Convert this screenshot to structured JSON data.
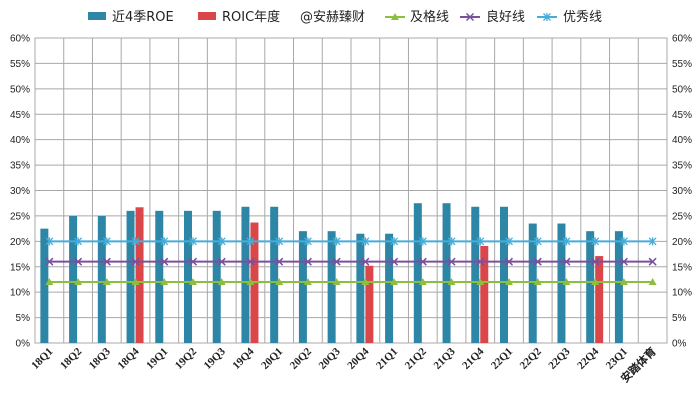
{
  "chart_data": {
    "type": "bar",
    "categories": [
      "18Q1",
      "18Q2",
      "18Q3",
      "18Q4",
      "19Q1",
      "19Q2",
      "19Q3",
      "19Q4",
      "20Q1",
      "20Q2",
      "20Q3",
      "20Q4",
      "21Q1",
      "21Q2",
      "21Q3",
      "21Q4",
      "22Q1",
      "22Q2",
      "22Q3",
      "22Q4",
      "23Q1",
      "安踏体育"
    ],
    "ylim": [
      0,
      60
    ],
    "y_ticks": [
      "0%",
      "5%",
      "10%",
      "15%",
      "20%",
      "25%",
      "30%",
      "35%",
      "40%",
      "45%",
      "50%",
      "55%",
      "60%"
    ],
    "y_tick_values": [
      0,
      5,
      10,
      15,
      20,
      25,
      30,
      35,
      40,
      45,
      50,
      55,
      60
    ],
    "grid": true,
    "legend_position": "top",
    "series": [
      {
        "name": "近4季ROE",
        "kind": "bar",
        "color": "#2e86a6",
        "values": [
          22.5,
          25,
          25,
          26,
          26,
          26,
          26,
          26.8,
          26.8,
          22,
          22,
          21.5,
          21.5,
          27.5,
          27.5,
          26.8,
          26.8,
          23.5,
          23.5,
          22,
          22,
          null
        ]
      },
      {
        "name": "ROIC年度",
        "kind": "bar",
        "color": "#d9474a",
        "values": [
          null,
          null,
          null,
          26.7,
          null,
          null,
          null,
          23.7,
          null,
          null,
          null,
          15.2,
          null,
          null,
          null,
          19.1,
          null,
          null,
          null,
          17.1,
          null,
          null
        ]
      },
      {
        "name": "及格线",
        "kind": "line",
        "marker": "triangle",
        "color": "#8cbf3f",
        "values": [
          12,
          12,
          12,
          12,
          12,
          12,
          12,
          12,
          12,
          12,
          12,
          12,
          12,
          12,
          12,
          12,
          12,
          12,
          12,
          12,
          12,
          12
        ]
      },
      {
        "name": "良好线",
        "kind": "line",
        "marker": "x",
        "color": "#7a4f9e",
        "values": [
          16,
          16,
          16,
          16,
          16,
          16,
          16,
          16,
          16,
          16,
          16,
          16,
          16,
          16,
          16,
          16,
          16,
          16,
          16,
          16,
          16,
          16
        ]
      },
      {
        "name": "优秀线",
        "kind": "line",
        "marker": "star",
        "color": "#43aedb",
        "values": [
          20,
          20,
          20,
          20,
          20,
          20,
          20,
          20,
          20,
          20,
          20,
          20,
          20,
          20,
          20,
          20,
          20,
          20,
          20,
          20,
          20,
          20
        ]
      }
    ],
    "legend_annotation": "@安赫臻财"
  }
}
